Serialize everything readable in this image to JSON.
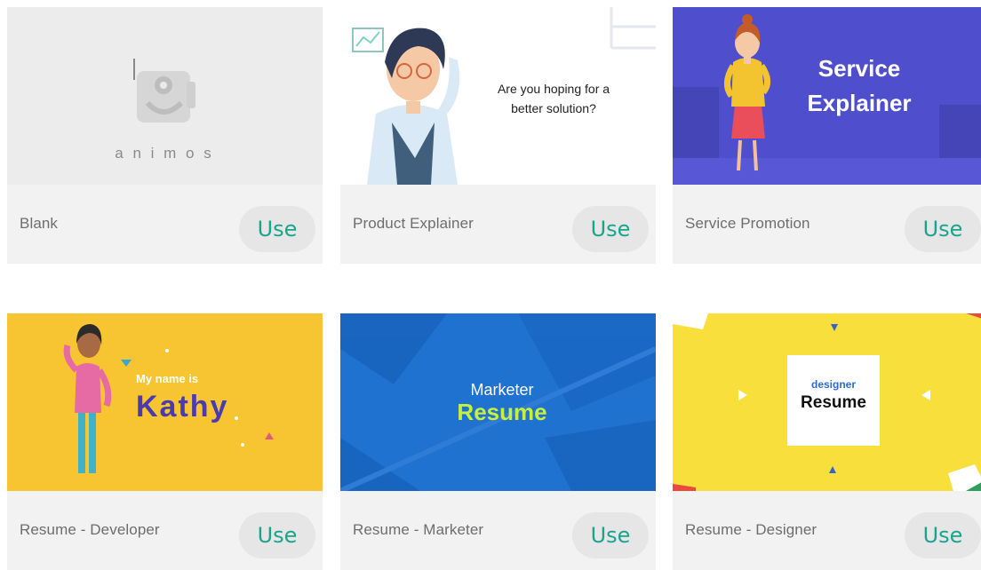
{
  "templates": [
    {
      "name": "Blank",
      "use_label": "Use",
      "thumb": {
        "logo_text": "a n i m o s"
      }
    },
    {
      "name": "Product Explainer",
      "use_label": "Use",
      "thumb": {
        "line1": "Are you hoping for a",
        "line2": "better solution?"
      }
    },
    {
      "name": "Service Promotion",
      "use_label": "Use",
      "thumb": {
        "line1": "Service",
        "line2": "Explainer"
      }
    },
    {
      "name": "Resume - Developer",
      "use_label": "Use",
      "thumb": {
        "line1": "My name is",
        "line2": "Kathy"
      }
    },
    {
      "name": "Resume - Marketer",
      "use_label": "Use",
      "thumb": {
        "line1": "Marketer",
        "line2": "Resume"
      }
    },
    {
      "name": "Resume - Designer",
      "use_label": "Use",
      "thumb": {
        "line1": "designer",
        "line2": "Resume"
      }
    }
  ],
  "colors": {
    "accent": "#18a58c",
    "service_bg": "#4f4fce",
    "yellow_bg": "#f7c531",
    "marketer_bg": "#1f72d0",
    "designer_bg": "#f8df3c"
  }
}
